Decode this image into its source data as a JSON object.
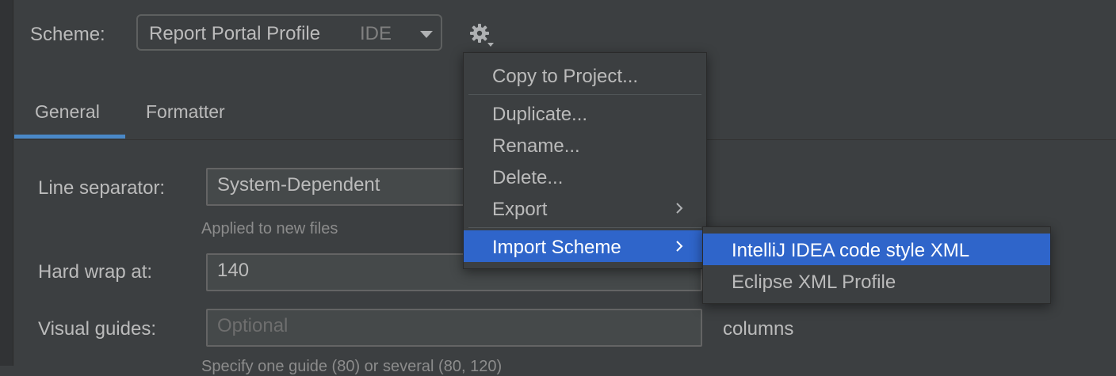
{
  "scheme": {
    "label": "Scheme:",
    "value": "Report Portal Profile",
    "tag": "IDE",
    "actions_icon": "gear-icon"
  },
  "tabs": [
    {
      "label": "General",
      "selected": true
    },
    {
      "label": "Formatter",
      "selected": false
    }
  ],
  "general": {
    "line_separator_label": "Line separator:",
    "line_separator_value": "System-Dependent",
    "applied_hint": "Applied to new files",
    "hard_wrap_label": "Hard wrap at:",
    "hard_wrap_value": "140",
    "visual_guides_label": "Visual guides:",
    "visual_guides_placeholder": "Optional",
    "columns_label": "columns",
    "visual_guides_hint": "Specify one guide (80) or several (80, 120)"
  },
  "menu": {
    "items": [
      {
        "label": "Copy to Project...",
        "has_submenu": false
      },
      {
        "label": "Duplicate...",
        "has_submenu": false
      },
      {
        "label": "Rename...",
        "has_submenu": false
      },
      {
        "label": "Delete...",
        "has_submenu": false
      },
      {
        "label": "Export",
        "has_submenu": true
      },
      {
        "label": "Import Scheme",
        "has_submenu": true,
        "selected": true
      }
    ]
  },
  "submenu": {
    "items": [
      {
        "label": "IntelliJ IDEA code style XML",
        "selected": true
      },
      {
        "label": "Eclipse XML Profile",
        "selected": false
      }
    ]
  },
  "colors": {
    "background": "#3c3f41",
    "selection": "#2f65ca",
    "tab_underline": "#4a88c7",
    "text": "#bbbbbb"
  }
}
